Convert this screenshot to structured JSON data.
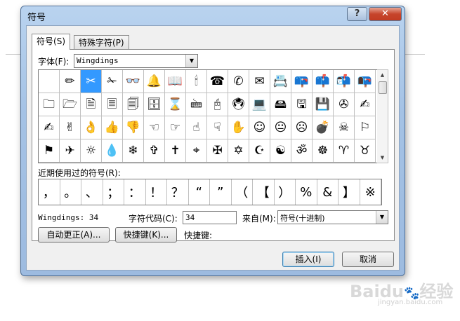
{
  "window": {
    "title": "符号",
    "help_icon": "?",
    "close_icon": "✕"
  },
  "tabs": [
    {
      "label": "符号",
      "key": "(S)",
      "active": true
    },
    {
      "label": "特殊字符",
      "key": "(P)",
      "active": false
    }
  ],
  "font": {
    "label": "字体(F):",
    "value": "Wingdings"
  },
  "symbols": [
    [
      " ",
      "✏",
      "✂",
      "✁",
      "👓",
      "🔔",
      "📖",
      "🕯",
      "☎",
      "✆",
      "✉",
      "📇",
      "📪",
      "📫",
      "📬",
      "📭"
    ],
    [
      "🗀",
      "🗁",
      "🗎",
      "🗏",
      "🗐",
      "🗄",
      "⌛",
      "🖮",
      "🖰",
      "🖲",
      "💻",
      "🖴",
      "🖫",
      "💾",
      "✇",
      "✍"
    ],
    [
      "✍",
      "✌",
      "👌",
      "👍",
      "👎",
      "☜",
      "☞",
      "☝",
      "☟",
      "✋",
      "☺",
      "😐",
      "☹",
      "💣",
      "☠",
      "⚐"
    ],
    [
      "⚑",
      "✈",
      "☼",
      "💧",
      "❄",
      "✞",
      "✝",
      "⌖",
      "✠",
      "✡",
      "☪",
      "☯",
      "ॐ",
      "☸",
      "♈",
      "♉"
    ]
  ],
  "selected_symbol": {
    "row": 0,
    "col": 2
  },
  "recent": {
    "label": "近期使用过的符号(R):",
    "items": [
      "，",
      "。",
      "、",
      "；",
      "：",
      "！",
      "？",
      "“",
      "”",
      "（",
      "【",
      "）",
      "%",
      "&",
      "】",
      "※"
    ]
  },
  "info": {
    "font_code": "Wingdings: 34",
    "char_code_label": "字符代码(C):",
    "char_code_value": "34",
    "from_label": "来自(M):",
    "from_value": "符号(十进制)"
  },
  "buttons": {
    "autocorrect": "自动更正(A)...",
    "shortcut": "快捷键(K)...",
    "shortcut_label": "快捷键:",
    "insert": "插入(I)",
    "cancel": "取消"
  },
  "watermark": {
    "logo": "Baidu",
    "logo_cn": "经验",
    "url": "jingyan.baidu.com"
  }
}
